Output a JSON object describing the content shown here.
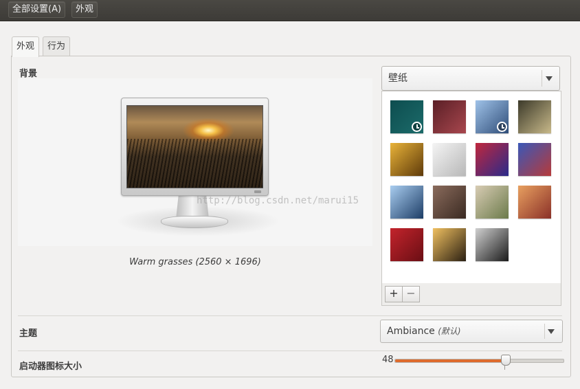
{
  "menubar": {
    "all_settings": "全部设置(A)",
    "appearance": "外观"
  },
  "tabs": [
    {
      "label": "外观",
      "active": true
    },
    {
      "label": "行为",
      "active": false
    }
  ],
  "background": {
    "section_label": "背景",
    "caption": "Warm grasses (2560 × 1696)",
    "source_combo": "壁纸"
  },
  "wallpapers": [
    {
      "name": "teal",
      "colors": [
        "#0d4d4f",
        "#1c6b6a"
      ],
      "timed": true
    },
    {
      "name": "maroon",
      "colors": [
        "#5a1f26",
        "#a8474e"
      ],
      "timed": false
    },
    {
      "name": "moon-lake",
      "colors": [
        "#9fc2e8",
        "#2f4d78"
      ],
      "timed": true
    },
    {
      "name": "bench",
      "colors": [
        "#3c3a2a",
        "#c8b98a"
      ],
      "timed": false
    },
    {
      "name": "golden-leaf",
      "colors": [
        "#e9b339",
        "#5e3a0a"
      ],
      "timed": false
    },
    {
      "name": "white-dunes",
      "colors": [
        "#f4f4f4",
        "#b8b8b8"
      ],
      "timed": false
    },
    {
      "name": "purple-tiles",
      "colors": [
        "#c0273d",
        "#2a2a8a"
      ],
      "timed": false
    },
    {
      "name": "turntable",
      "colors": [
        "#3a58b8",
        "#b63a3a"
      ],
      "timed": false
    },
    {
      "name": "blue-coast",
      "colors": [
        "#a9cdf0",
        "#1d3d66"
      ],
      "timed": false
    },
    {
      "name": "pebbles",
      "colors": [
        "#8a6b5c",
        "#3a2a22"
      ],
      "timed": false
    },
    {
      "name": "valley",
      "colors": [
        "#d8ccb4",
        "#6b7a4a"
      ],
      "timed": false
    },
    {
      "name": "red-bokeh",
      "colors": [
        "#e8a060",
        "#8a3028"
      ],
      "timed": false
    },
    {
      "name": "ubuntu-red",
      "colors": [
        "#c3242c",
        "#6a0e14"
      ],
      "timed": false
    },
    {
      "name": "warm-grasses",
      "colors": [
        "#f0c060",
        "#2a1f12"
      ],
      "timed": false
    },
    {
      "name": "building-bw",
      "colors": [
        "#d0d0d0",
        "#1a1a1a"
      ],
      "timed": false
    }
  ],
  "wallpaper_tools": {
    "add": "+",
    "remove": "−"
  },
  "theme": {
    "label": "主题",
    "value": "Ambiance",
    "hint": "(默认)"
  },
  "launcher": {
    "label": "启动器图标大小",
    "value": "48",
    "level": 0.66
  },
  "watermark": "http://blog.csdn.net/marui15",
  "colors": {
    "accent": "#de6b2d",
    "topbar": "#3d3b37"
  }
}
